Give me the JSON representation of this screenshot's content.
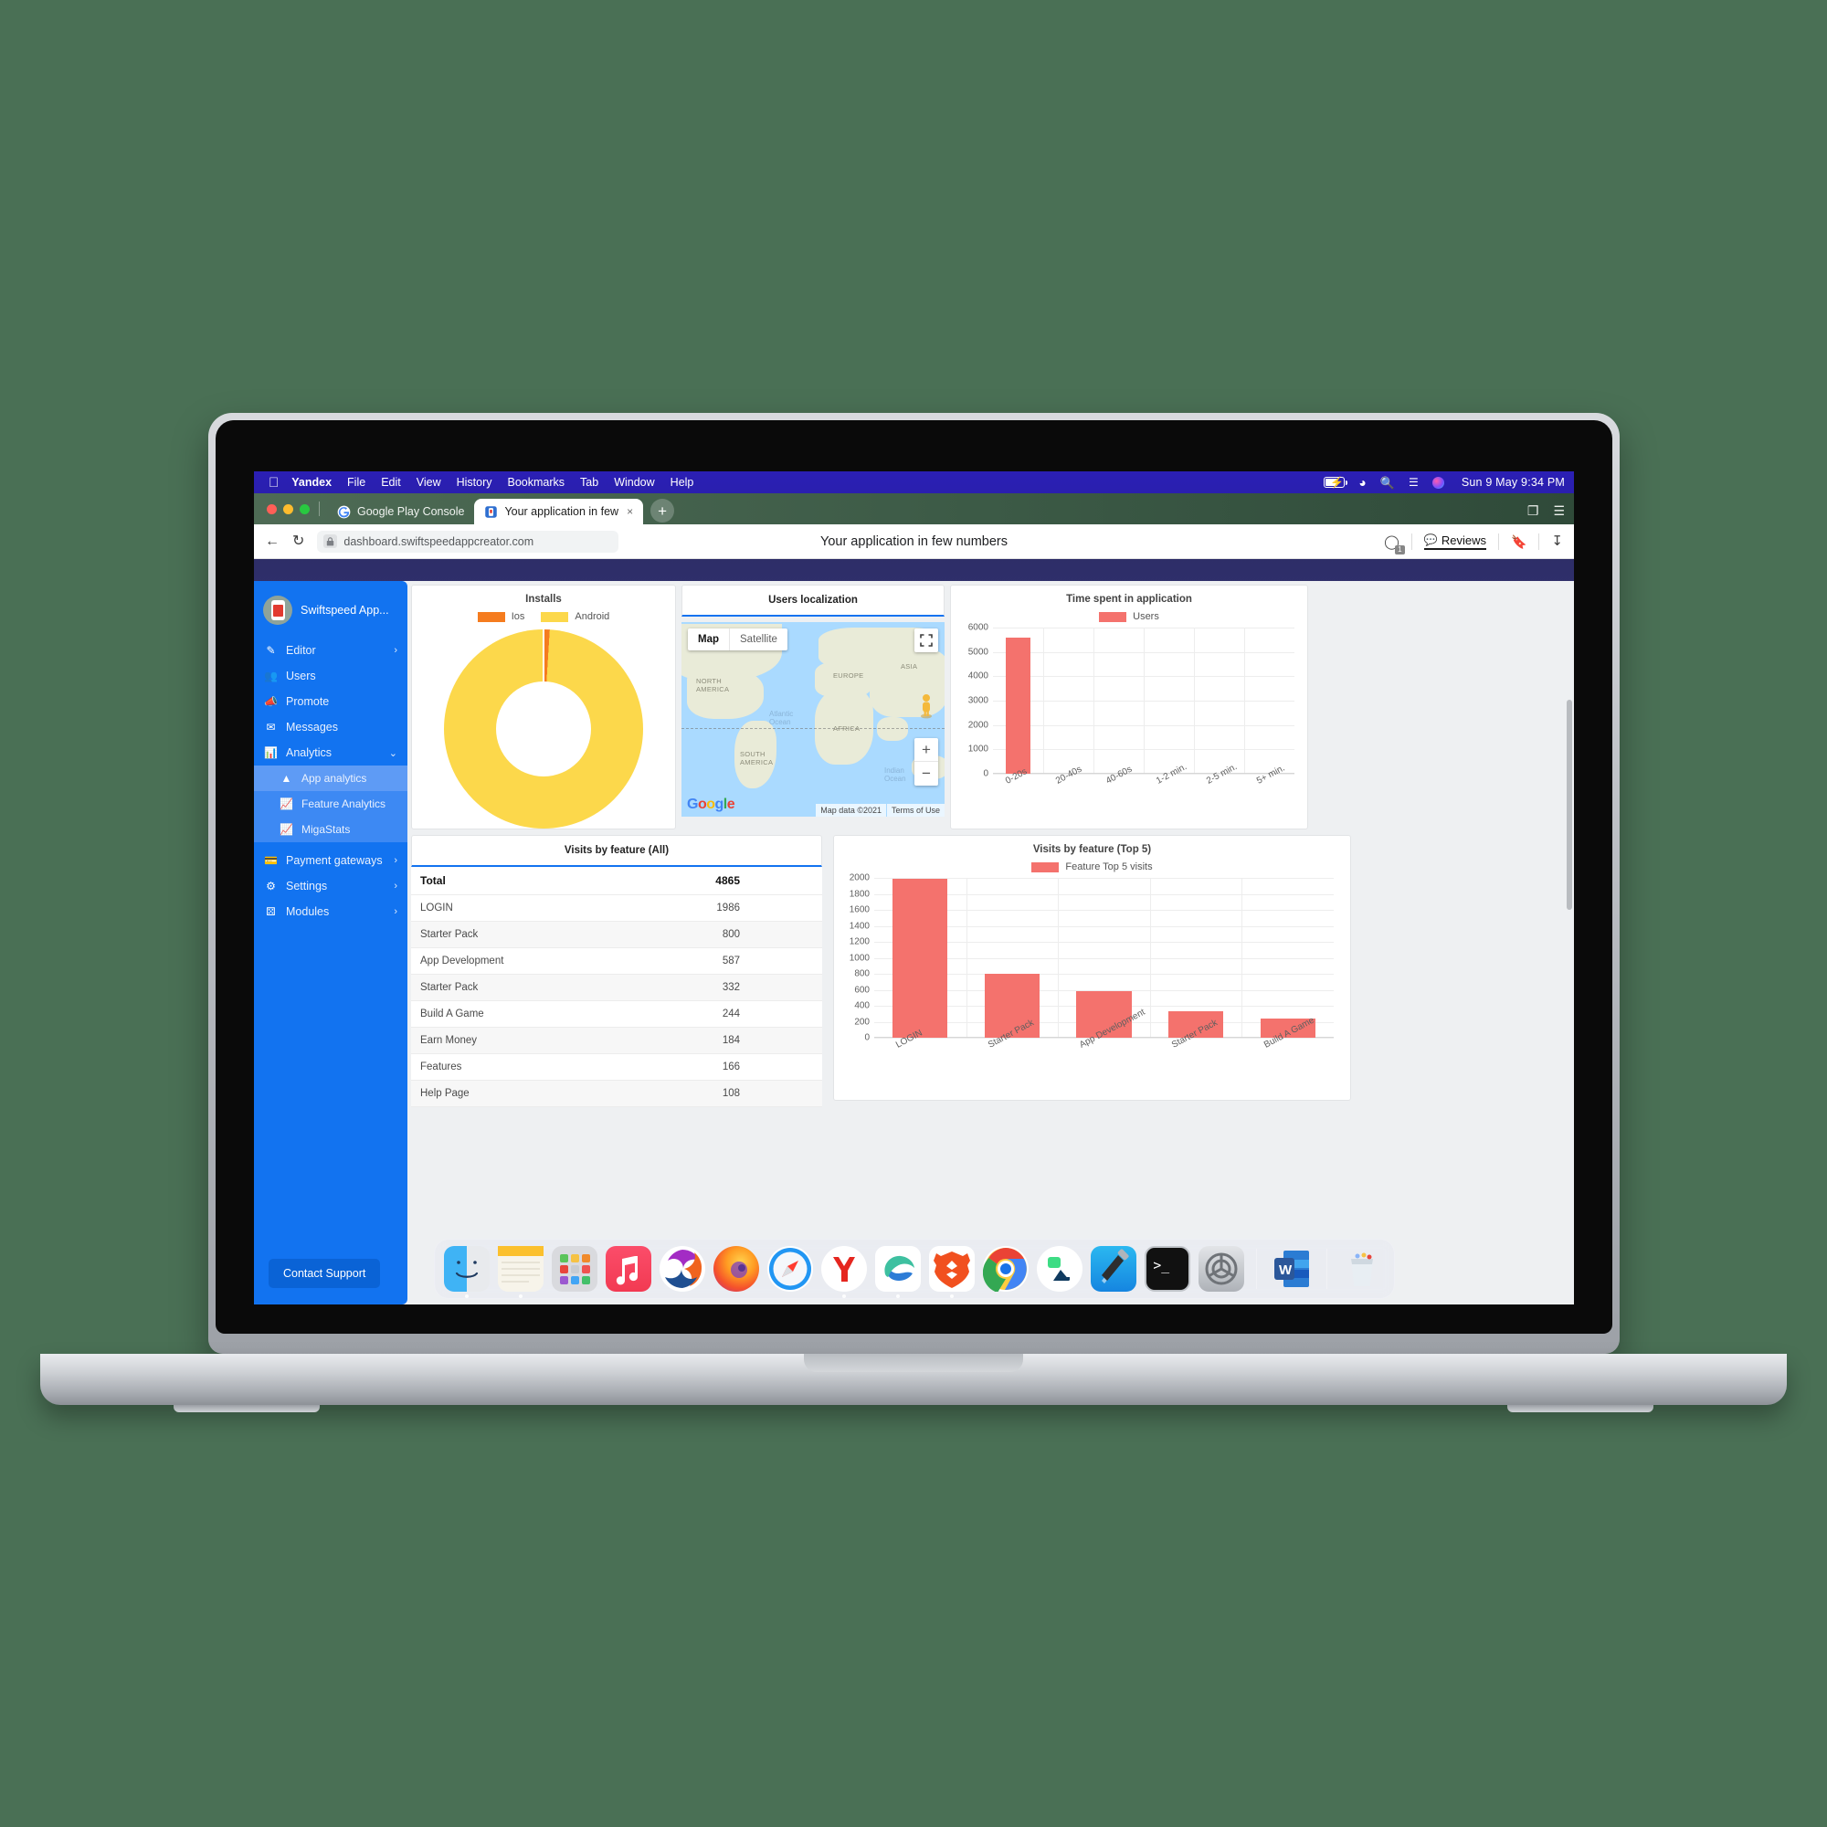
{
  "menubar": {
    "apple_icon": "apple-icon",
    "items": [
      "Yandex",
      "File",
      "Edit",
      "View",
      "History",
      "Bookmarks",
      "Tab",
      "Window",
      "Help"
    ],
    "status_icons": [
      "battery-charging-icon",
      "wifi-icon",
      "search-icon",
      "control-center-icon",
      "siri-icon"
    ],
    "clock": "Sun 9 May  9:34 PM",
    "battery_bolt": "⚡"
  },
  "browser": {
    "window_lights": [
      "#ff5f57",
      "#febc2e",
      "#28c840"
    ],
    "tabs": [
      {
        "label": "Google Play Console",
        "favicon": "google-play-console-icon",
        "active": false
      },
      {
        "label": "Your application in few",
        "favicon": "swiftspeed-icon",
        "active": true,
        "close": "×"
      }
    ],
    "new_tab": "+",
    "tabstrip_right_icons": [
      "tab-overview-icon",
      "menu-icon"
    ],
    "toolbar": {
      "back": "←",
      "reload": "↻",
      "lock_icon": "lock-icon",
      "url": "dashboard.swiftspeedappcreator.com",
      "page_title": "Your application in few numbers",
      "notifications_count": "1",
      "reviews_label": "Reviews",
      "bookmark_icon": "bookmark-icon",
      "download_icon": "download-icon"
    }
  },
  "sidebar": {
    "brand": "Swiftspeed App...",
    "items": [
      {
        "label": "Editor",
        "icon": "pencil-icon",
        "chevron": "›"
      },
      {
        "label": "Users",
        "icon": "users-icon",
        "chevron": ""
      },
      {
        "label": "Promote",
        "icon": "megaphone-icon",
        "chevron": ""
      },
      {
        "label": "Messages",
        "icon": "envelope-icon",
        "chevron": ""
      },
      {
        "label": "Analytics",
        "icon": "chart-icon",
        "chevron": "⌄"
      }
    ],
    "sub_items": [
      {
        "label": "App analytics",
        "icon": "area-chart-icon",
        "state": "active-light"
      },
      {
        "label": "Feature Analytics",
        "icon": "bar-chart-icon",
        "state": "active-mid"
      },
      {
        "label": "MigaStats",
        "icon": "bar-chart-icon",
        "state": "active-mid"
      }
    ],
    "items_bottom": [
      {
        "label": "Payment gateways",
        "icon": "credit-card-icon",
        "chevron": "›"
      },
      {
        "label": "Settings",
        "icon": "gears-icon",
        "chevron": "›"
      },
      {
        "label": "Modules",
        "icon": "modules-icon",
        "chevron": "›"
      }
    ],
    "contact_support": "Contact Support",
    "bg_color": "#1273f0"
  },
  "map_panel": {
    "title": "Users localization",
    "map_button": "Map",
    "satellite_button": "Satellite",
    "fullscreen_icon": "fullscreen-icon",
    "pegman_icon": "street-view-pegman-icon",
    "zoom_in": "+",
    "zoom_out": "−",
    "logo_letters": [
      "G",
      "o",
      "o",
      "g",
      "l",
      "e"
    ],
    "attribution": [
      "Map data ©2021",
      "Terms of Use"
    ],
    "labels": [
      "NORTH AMERICA",
      "SOUTH AMERICA",
      "EUROPE",
      "AFRICA",
      "ASIA",
      "Atlantic Ocean",
      "Indian Ocean"
    ]
  },
  "table_panel": {
    "title": "Visits by feature (All)",
    "rows": [
      {
        "name": "Total",
        "value": "4865",
        "total": true
      },
      {
        "name": "LOGIN",
        "value": "1986"
      },
      {
        "name": "Starter Pack",
        "value": "800"
      },
      {
        "name": "App Development",
        "value": "587"
      },
      {
        "name": "Starter Pack",
        "value": "332"
      },
      {
        "name": "Build A Game",
        "value": "244"
      },
      {
        "name": "Earn Money",
        "value": "184"
      },
      {
        "name": "Features",
        "value": "166"
      },
      {
        "name": "Help Page",
        "value": "108"
      }
    ]
  },
  "chart_data": [
    {
      "type": "pie",
      "title": "Installs",
      "id": "installs-donut",
      "legend_position": "top",
      "labels": [
        "Ios",
        "Android"
      ],
      "colors": [
        "#f57c1f",
        "#fcd84b"
      ],
      "values": [
        1,
        99
      ],
      "slices": [
        {
          "label": "Ios",
          "value": 1,
          "color": "#f57c1f"
        },
        {
          "label": "Android",
          "value": 99,
          "color": "#fcd84b"
        }
      ]
    },
    {
      "type": "bar",
      "id": "time-spent-chart",
      "title": "Time spent in application",
      "legend": [
        "Users"
      ],
      "color": "#f4726d",
      "categories": [
        "0-20s",
        "20-40s",
        "40-60s",
        "1-2 min.",
        "2-5 min.",
        "5+ min."
      ],
      "values": [
        5580,
        0,
        0,
        0,
        0,
        0
      ],
      "yticks": [
        0,
        1000,
        2000,
        3000,
        4000,
        5000,
        6000
      ],
      "ylim": [
        0,
        6000
      ],
      "xlabel": "",
      "ylabel": "",
      "grid": true
    },
    {
      "type": "bar",
      "id": "visits-top5-chart",
      "title": "Visits by feature (Top 5)",
      "legend": [
        "Feature Top 5 visits"
      ],
      "color": "#f4726d",
      "categories": [
        "LOGIN",
        "Starter Pack",
        "App Development",
        "Starter Pack",
        "Build A Game"
      ],
      "values": [
        1986,
        800,
        587,
        332,
        244
      ],
      "yticks": [
        0,
        200,
        400,
        600,
        800,
        1000,
        1200,
        1400,
        1600,
        1800,
        2000
      ],
      "ylim": [
        0,
        2000
      ],
      "xlabel": "",
      "ylabel": "",
      "grid": true
    }
  ],
  "dock": {
    "apps": [
      {
        "name": "finder-icon"
      },
      {
        "name": "notes-icon"
      },
      {
        "name": "launchpad-icon"
      },
      {
        "name": "music-icon"
      },
      {
        "name": "seamonkey-icon"
      },
      {
        "name": "firefox-icon"
      },
      {
        "name": "safari-icon"
      },
      {
        "name": "yandex-icon"
      },
      {
        "name": "edge-icon"
      },
      {
        "name": "brave-icon"
      },
      {
        "name": "chrome-icon"
      },
      {
        "name": "android-studio-icon"
      },
      {
        "name": "xcode-icon"
      },
      {
        "name": "terminal-icon"
      },
      {
        "name": "system-preferences-icon"
      },
      {
        "name": "microsoft-word-icon"
      },
      {
        "name": "trash-icon"
      }
    ]
  }
}
